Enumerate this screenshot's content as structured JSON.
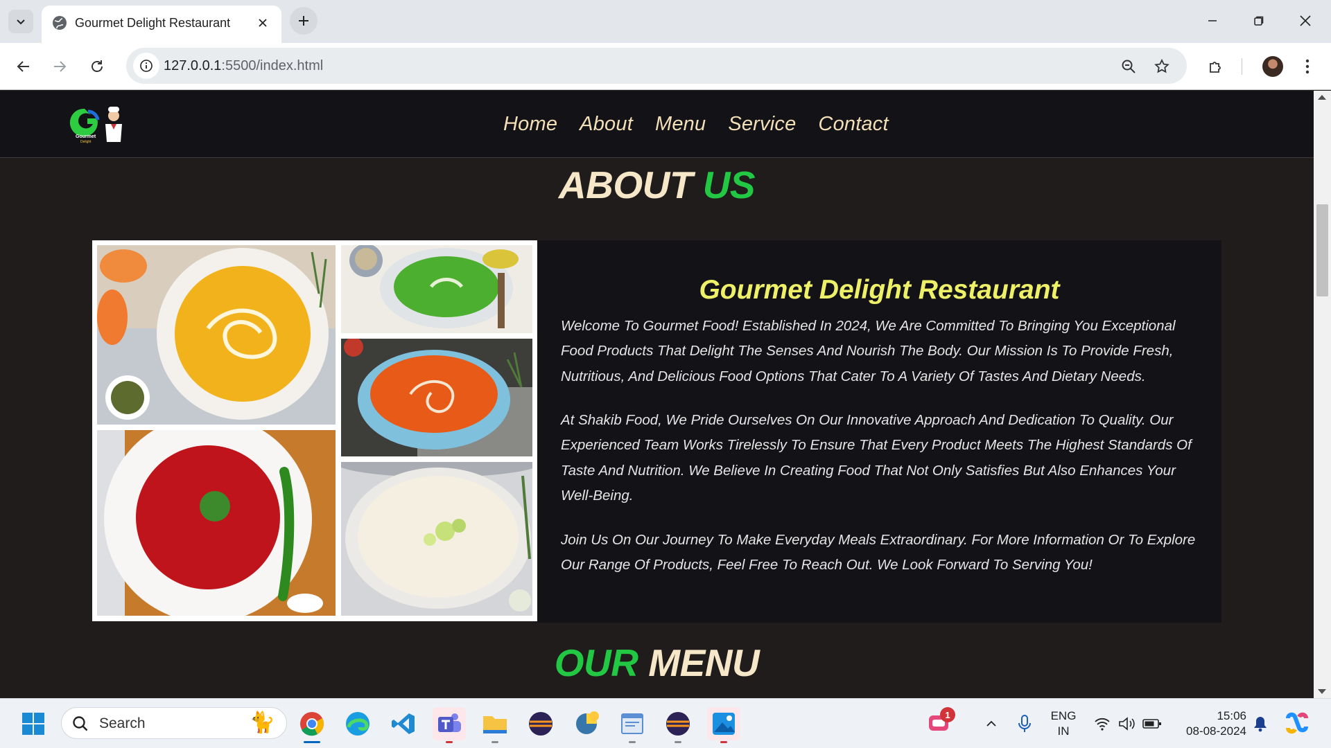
{
  "browser": {
    "tab_title": "Gourmet Delight Restaurant",
    "url_host": "127.0.0.1",
    "url_rest": ":5500/index.html"
  },
  "site": {
    "logo_text": "Gourmet",
    "logo_subtext": "Delight",
    "nav": [
      "Home",
      "About",
      "Menu",
      "Service",
      "Contact"
    ],
    "about_title_1": "ABOUT",
    "about_title_2": "US",
    "about_heading": "Gourmet Delight Restaurant",
    "paragraphs": [
      "Welcome To Gourmet Food! Established In 2024, We Are Committed To Bringing You Exceptional Food Products That Delight The Senses And Nourish The Body. Our Mission Is To Provide Fresh, Nutritious, And Delicious Food Options That Cater To A Variety Of Tastes And Dietary Needs.",
      "At Shakib Food, We Pride Ourselves On Our Innovative Approach And Dedication To Quality. Our Experienced Team Works Tirelessly To Ensure That Every Product Meets The Highest Standards Of Taste And Nutrition. We Believe In Creating Food That Not Only Satisfies But Also Enhances Your Well-Being.",
      "Join Us On Our Journey To Make Everyday Meals Extraordinary. For More Information Or To Explore Our Range Of Products, Feel Free To Reach Out. We Look Forward To Serving You!"
    ],
    "menu_title_1": "OUR",
    "menu_title_2": "MENU"
  },
  "taskbar": {
    "search_label": "Search",
    "notification_count": "1",
    "lang_1": "ENG",
    "lang_2": "IN",
    "time": "15:06",
    "date": "08-08-2024"
  },
  "colors": {
    "header_bg": "#131217",
    "page_bg": "#211c1c",
    "nav_text": "#f3dfb8",
    "accent_green": "#22c744",
    "heading_yellow": "#eef067"
  }
}
